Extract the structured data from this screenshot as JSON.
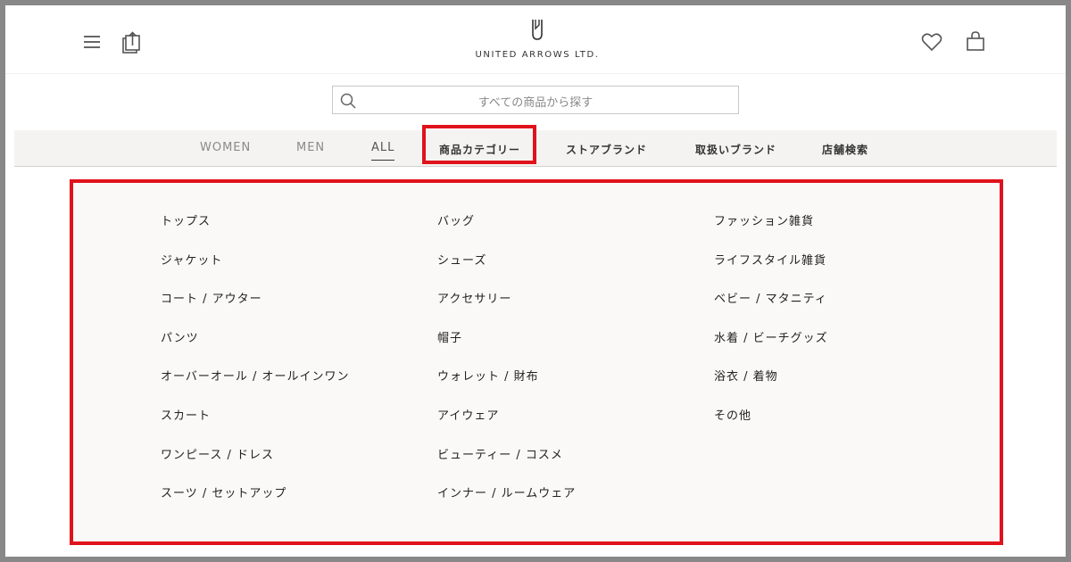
{
  "header": {
    "logo_text": "UNITED ARROWS LTD."
  },
  "search": {
    "placeholder": "すべての商品から探す"
  },
  "nav": {
    "women": "WOMEN",
    "men": "MEN",
    "all": "ALL",
    "category": "商品カテゴリー",
    "store_brand": "ストアブランド",
    "handled_brand": "取扱いブランド",
    "store_search": "店舗検索"
  },
  "categories": {
    "col1": [
      "トップス",
      "ジャケット",
      "コート / アウター",
      "パンツ",
      "オーバーオール / オールインワン",
      "スカート",
      "ワンピース / ドレス",
      "スーツ / セットアップ"
    ],
    "col2": [
      "バッグ",
      "シューズ",
      "アクセサリー",
      "帽子",
      "ウォレット / 財布",
      "アイウェア",
      "ビューティー / コスメ",
      "インナー / ルームウェア"
    ],
    "col3": [
      "ファッション雑貨",
      "ライフスタイル雑貨",
      "ベビー / マタニティ",
      "水着 / ビーチグッズ",
      "浴衣 / 着物",
      "その他"
    ]
  },
  "colors": {
    "highlight": "#e0121b",
    "nav_bg": "#f4f3f1",
    "panel_bg": "#faf9f7"
  },
  "icons": [
    "menu-icon",
    "share-icon",
    "logo-icon",
    "heart-icon",
    "bag-icon",
    "search-icon"
  ]
}
